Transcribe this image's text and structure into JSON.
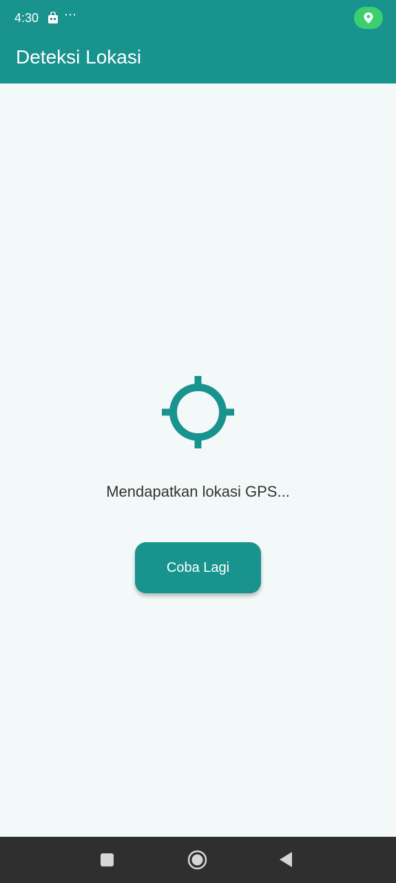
{
  "status_bar": {
    "time": "4:30",
    "more_indicator": "⋯",
    "icons": [
      "store-notification-icon",
      "location-icon"
    ],
    "pill_color": "#3ccf6f"
  },
  "app_bar": {
    "title": "Deteksi Lokasi",
    "color": "#18938e"
  },
  "main": {
    "icon": "gps-crosshair-icon",
    "message": "Mendapatkan lokasi GPS...",
    "retry_label": "Coba Lagi",
    "background": "#f3f9f8"
  },
  "nav_bar": {
    "buttons": [
      "recents-icon",
      "home-icon",
      "back-icon"
    ]
  }
}
